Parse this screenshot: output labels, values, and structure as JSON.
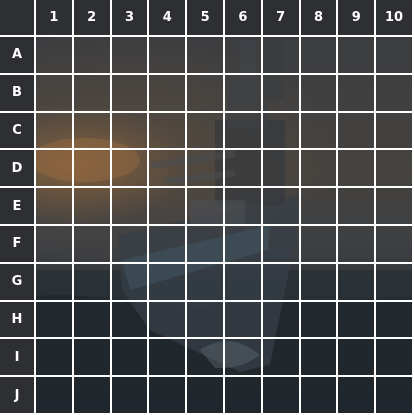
{
  "board": {
    "columns": [
      "1",
      "2",
      "3",
      "4",
      "5",
      "6",
      "7",
      "8",
      "9",
      "10"
    ],
    "rows": [
      "A",
      "B",
      "C",
      "D",
      "E",
      "F",
      "G",
      "H",
      "I",
      "J"
    ]
  },
  "background": {
    "image": "warship-at-sea",
    "grid_line_color": "#ffffff",
    "header_color": "#2e2f33"
  }
}
